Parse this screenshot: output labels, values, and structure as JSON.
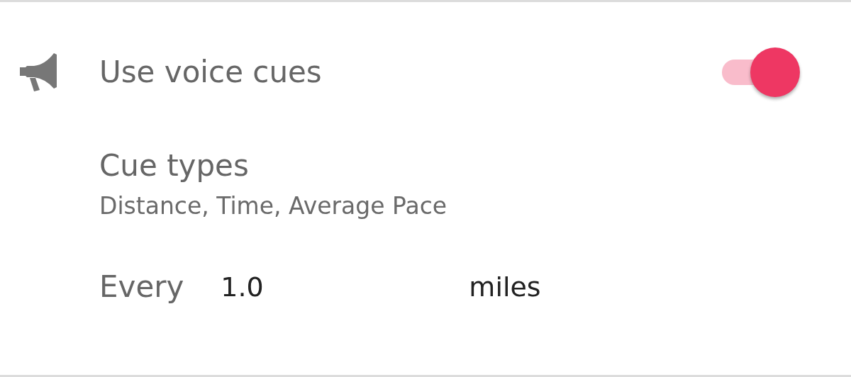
{
  "voice_cues": {
    "label": "Use voice cues",
    "on": true
  },
  "cue_types": {
    "title": "Cue types",
    "summary": "Distance, Time, Average Pace"
  },
  "interval": {
    "label": "Every",
    "value": "1.0",
    "unit": "miles"
  }
}
